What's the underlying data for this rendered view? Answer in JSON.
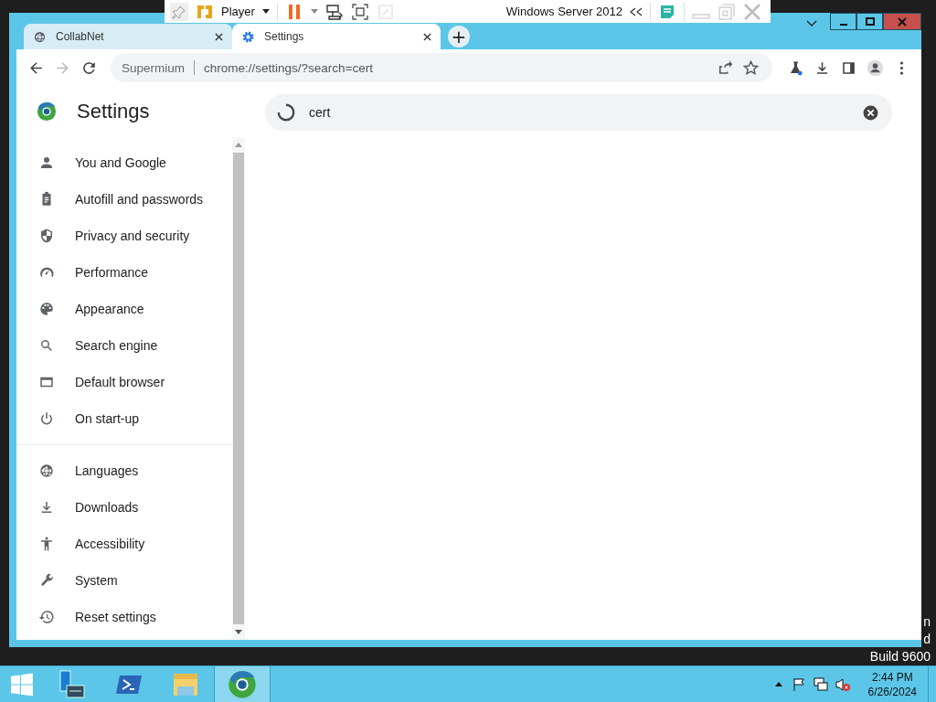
{
  "vm_toolbar": {
    "menu": "Player",
    "vm_name": "Windows Server 2012"
  },
  "tabs": [
    {
      "title": "CollabNet",
      "kind": "globe",
      "selected": false
    },
    {
      "title": "Settings",
      "kind": "gear",
      "selected": true
    }
  ],
  "new_tab": "+",
  "address": {
    "site": "Supermium",
    "url": "chrome://settings/?search=cert"
  },
  "settings": {
    "title": "Settings",
    "search_value": "cert",
    "loading": true
  },
  "sidebar": {
    "groups": [
      [
        {
          "label": "You and Google",
          "kind": "person"
        },
        {
          "label": "Autofill and passwords",
          "kind": "clipboard"
        },
        {
          "label": "Privacy and security",
          "kind": "shield"
        },
        {
          "label": "Performance",
          "kind": "gauge"
        },
        {
          "label": "Appearance",
          "kind": "palette"
        },
        {
          "label": "Search engine",
          "kind": "search"
        },
        {
          "label": "Default browser",
          "kind": "window"
        },
        {
          "label": "On start-up",
          "kind": "power"
        }
      ],
      [
        {
          "label": "Languages",
          "kind": "globe"
        },
        {
          "label": "Downloads",
          "kind": "download"
        },
        {
          "label": "Accessibility",
          "kind": "accessibility"
        },
        {
          "label": "System",
          "kind": "wrench"
        },
        {
          "label": "Reset settings",
          "kind": "history"
        }
      ]
    ]
  },
  "desktop_text": [
    "n",
    "d",
    "Build 9600"
  ],
  "taskbar": {
    "apps": [
      {
        "kind": "server-manager",
        "selected": false
      },
      {
        "kind": "powershell",
        "selected": false
      },
      {
        "kind": "explorer",
        "selected": false
      },
      {
        "kind": "browser",
        "selected": true
      }
    ]
  },
  "clock": {
    "time": "2:44 PM",
    "date": "6/26/2024"
  }
}
